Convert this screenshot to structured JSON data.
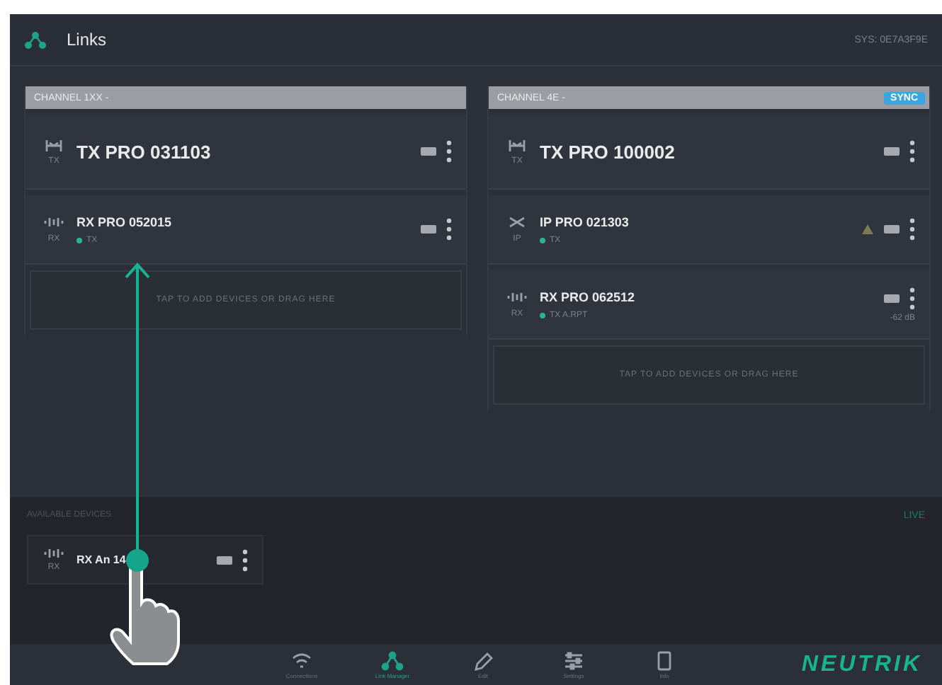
{
  "header": {
    "title": "Links",
    "info": "SYS: 0E7A3F9E"
  },
  "channels": [
    {
      "label": "CHANNEL 1XX -",
      "devices": [
        {
          "kind": "tx",
          "name": "TX PRO 031103",
          "sub": "TX",
          "warning": false
        },
        {
          "kind": "rx",
          "name": "RX PRO 052015",
          "sub": "RX",
          "link": "TX",
          "warning": false
        }
      ],
      "dropzone": "TAP TO ADD DEVICES OR DRAG HERE"
    },
    {
      "label": "CHANNEL 4E -",
      "badge": "SYNC",
      "devices": [
        {
          "kind": "tx",
          "name": "TX PRO 100002",
          "sub": "TX",
          "warning": false
        },
        {
          "kind": "ip",
          "name": "IP PRO 021303",
          "sub": "IP",
          "link": "TX",
          "warning": true
        },
        {
          "kind": "rx",
          "name": "RX PRO 062512",
          "sub": "RX",
          "link": "TX A.RPT",
          "warning": false,
          "reading": "-62 dB"
        }
      ],
      "dropzone": "TAP TO ADD DEVICES OR DRAG HERE"
    }
  ],
  "available": {
    "title": "AVAILABLE DEVICES",
    "action": "LIVE",
    "devices": [
      {
        "kind": "rx",
        "name": "RX An 14",
        "sub": "RX"
      }
    ]
  },
  "nav": [
    {
      "label": "Connections",
      "kind": "wifi",
      "selected": false
    },
    {
      "label": "Link Manager",
      "kind": "links",
      "selected": true
    },
    {
      "label": "Edit",
      "kind": "pen",
      "selected": false
    },
    {
      "label": "Settings",
      "kind": "sliders",
      "selected": false
    },
    {
      "label": "Info",
      "kind": "tablet",
      "selected": false
    }
  ],
  "brand": "NEUTRIK"
}
